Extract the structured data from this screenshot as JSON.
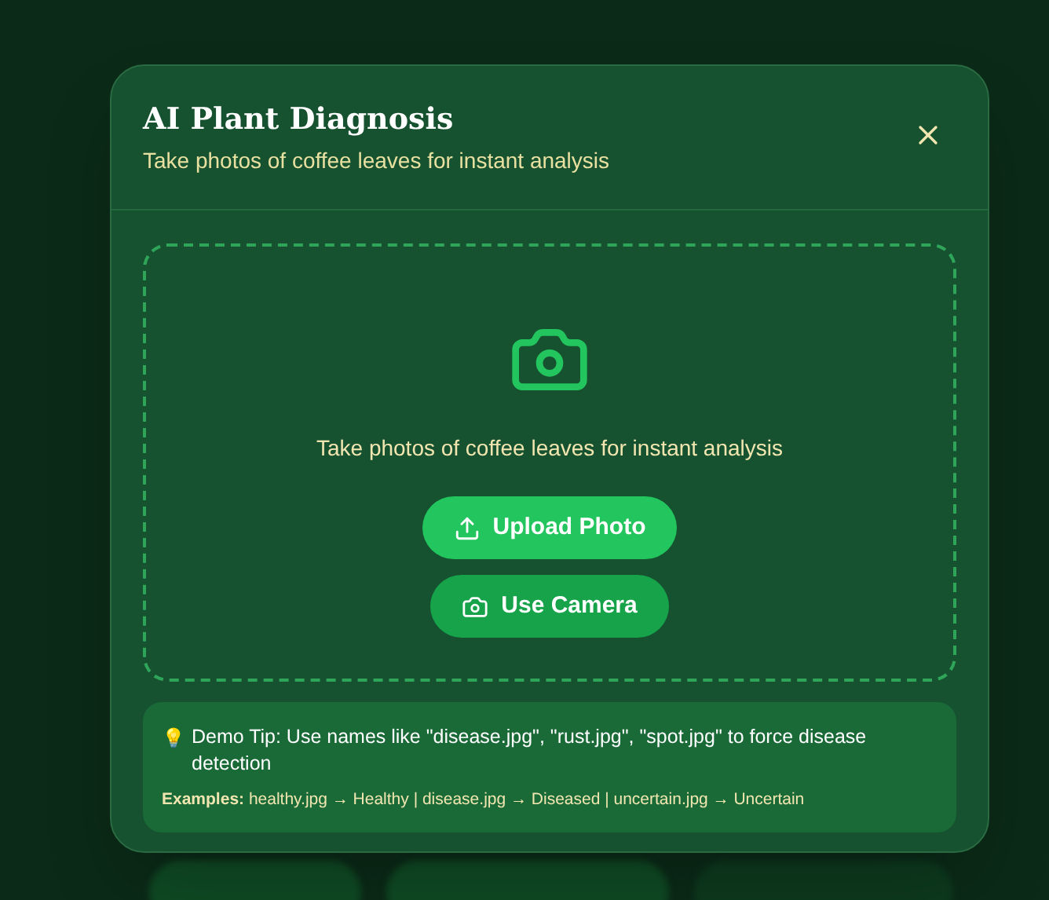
{
  "dialog": {
    "title": "AI Plant Diagnosis",
    "subtitle": "Take photos of coffee leaves for instant analysis"
  },
  "dropzone": {
    "prompt": "Take photos of coffee leaves for instant analysis",
    "buttons": [
      {
        "label": "Upload Photo",
        "kind": "upload"
      },
      {
        "label": "Use Camera",
        "kind": "camera"
      }
    ]
  },
  "tip": {
    "icon": "💡",
    "text": "Demo Tip: Use names like \"disease.jpg\", \"rust.jpg\", \"spot.jpg\" to force disease detection",
    "examples_label": "Examples:",
    "examples": "healthy.jpg → Healthy | disease.jpg → Diseased | uncertain.jpg → Uncertain"
  }
}
